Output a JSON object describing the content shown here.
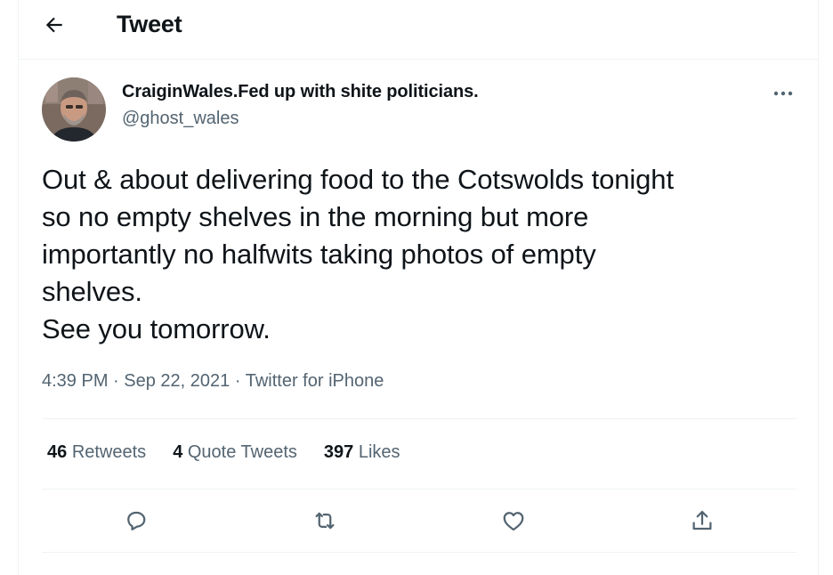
{
  "header": {
    "title": "Tweet",
    "back_icon": "arrow-left-icon"
  },
  "tweet": {
    "author": {
      "display_name": "CraiginWales.Fed up with shite politicians.",
      "handle": "@ghost_wales"
    },
    "text": "Out & about delivering food to the Cotswolds tonight\nso no empty shelves in the morning but more\nimportantly no halfwits taking photos of empty\nshelves.\nSee you tomorrow.",
    "time": "4:39 PM",
    "separator": "·",
    "date": "Sep 22, 2021",
    "source": "Twitter for iPhone",
    "stats": {
      "retweets_count": "46",
      "retweets_label": "Retweets",
      "quotes_count": "4",
      "quotes_label": "Quote Tweets",
      "likes_count": "397",
      "likes_label": "Likes"
    },
    "actions": [
      "reply-icon",
      "retweet-icon",
      "like-icon",
      "share-icon"
    ]
  },
  "colors": {
    "text_primary": "#0f1419",
    "text_secondary": "#536471",
    "divider": "#eff3f4"
  }
}
